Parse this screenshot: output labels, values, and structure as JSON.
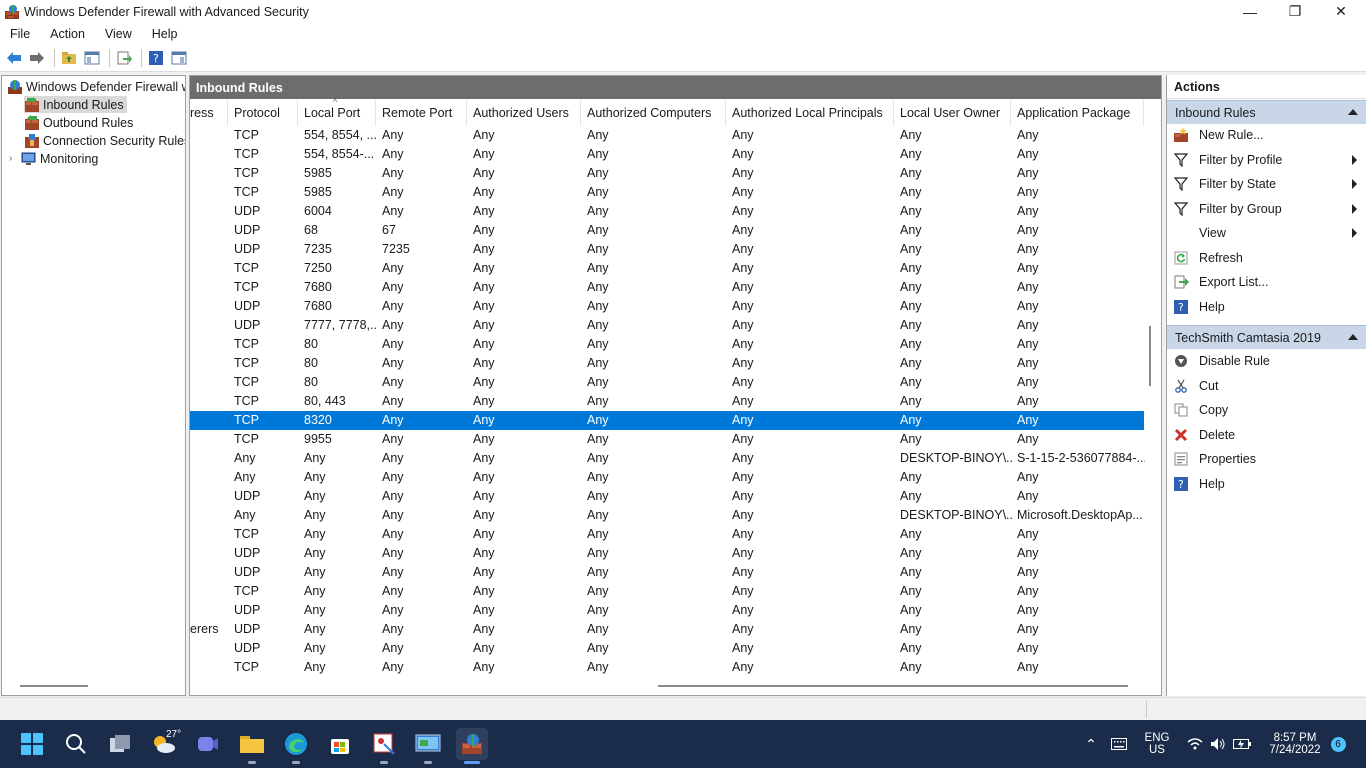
{
  "window": {
    "title": "Windows Defender Firewall with Advanced Security",
    "minimize": "—",
    "maximize": "❐",
    "close": "✕"
  },
  "menu": [
    "File",
    "Action",
    "View",
    "Help"
  ],
  "tree": {
    "root": "Windows Defender Firewall wi",
    "items": [
      "Inbound Rules",
      "Outbound Rules",
      "Connection Security Rules",
      "Monitoring"
    ]
  },
  "center": {
    "header": "Inbound Rules",
    "columns": [
      "ress",
      "Protocol",
      "Local Port",
      "Remote Port",
      "Authorized Users",
      "Authorized Computers",
      "Authorized Local Principals",
      "Local User Owner",
      "Application Package"
    ],
    "rows": [
      [
        "",
        "TCP",
        "554, 8554, ...",
        "Any",
        "Any",
        "Any",
        "Any",
        "Any",
        "Any"
      ],
      [
        "",
        "TCP",
        "554, 8554-...",
        "Any",
        "Any",
        "Any",
        "Any",
        "Any",
        "Any"
      ],
      [
        "",
        "TCP",
        "5985",
        "Any",
        "Any",
        "Any",
        "Any",
        "Any",
        "Any"
      ],
      [
        "",
        "TCP",
        "5985",
        "Any",
        "Any",
        "Any",
        "Any",
        "Any",
        "Any"
      ],
      [
        "",
        "UDP",
        "6004",
        "Any",
        "Any",
        "Any",
        "Any",
        "Any",
        "Any"
      ],
      [
        "",
        "UDP",
        "68",
        "67",
        "Any",
        "Any",
        "Any",
        "Any",
        "Any"
      ],
      [
        "",
        "UDP",
        "7235",
        "7235",
        "Any",
        "Any",
        "Any",
        "Any",
        "Any"
      ],
      [
        "",
        "TCP",
        "7250",
        "Any",
        "Any",
        "Any",
        "Any",
        "Any",
        "Any"
      ],
      [
        "",
        "TCP",
        "7680",
        "Any",
        "Any",
        "Any",
        "Any",
        "Any",
        "Any"
      ],
      [
        "",
        "UDP",
        "7680",
        "Any",
        "Any",
        "Any",
        "Any",
        "Any",
        "Any"
      ],
      [
        "",
        "UDP",
        "7777, 7778,...",
        "Any",
        "Any",
        "Any",
        "Any",
        "Any",
        "Any"
      ],
      [
        "",
        "TCP",
        "80",
        "Any",
        "Any",
        "Any",
        "Any",
        "Any",
        "Any"
      ],
      [
        "",
        "TCP",
        "80",
        "Any",
        "Any",
        "Any",
        "Any",
        "Any",
        "Any"
      ],
      [
        "",
        "TCP",
        "80",
        "Any",
        "Any",
        "Any",
        "Any",
        "Any",
        "Any"
      ],
      [
        "",
        "TCP",
        "80, 443",
        "Any",
        "Any",
        "Any",
        "Any",
        "Any",
        "Any"
      ],
      [
        "",
        "TCP",
        "8320",
        "Any",
        "Any",
        "Any",
        "Any",
        "Any",
        "Any"
      ],
      [
        "",
        "TCP",
        "9955",
        "Any",
        "Any",
        "Any",
        "Any",
        "Any",
        "Any"
      ],
      [
        "",
        "Any",
        "Any",
        "Any",
        "Any",
        "Any",
        "Any",
        "DESKTOP-BINOY\\...",
        "S-1-15-2-536077884-..."
      ],
      [
        "",
        "Any",
        "Any",
        "Any",
        "Any",
        "Any",
        "Any",
        "Any",
        "Any"
      ],
      [
        "",
        "UDP",
        "Any",
        "Any",
        "Any",
        "Any",
        "Any",
        "Any",
        "Any"
      ],
      [
        "",
        "Any",
        "Any",
        "Any",
        "Any",
        "Any",
        "Any",
        "DESKTOP-BINOY\\...",
        "Microsoft.DesktopAp..."
      ],
      [
        "",
        "TCP",
        "Any",
        "Any",
        "Any",
        "Any",
        "Any",
        "Any",
        "Any"
      ],
      [
        "",
        "UDP",
        "Any",
        "Any",
        "Any",
        "Any",
        "Any",
        "Any",
        "Any"
      ],
      [
        "",
        "UDP",
        "Any",
        "Any",
        "Any",
        "Any",
        "Any",
        "Any",
        "Any"
      ],
      [
        "",
        "TCP",
        "Any",
        "Any",
        "Any",
        "Any",
        "Any",
        "Any",
        "Any"
      ],
      [
        "",
        "UDP",
        "Any",
        "Any",
        "Any",
        "Any",
        "Any",
        "Any",
        "Any"
      ],
      [
        "erers",
        "UDP",
        "Any",
        "Any",
        "Any",
        "Any",
        "Any",
        "Any",
        "Any"
      ],
      [
        "",
        "UDP",
        "Any",
        "Any",
        "Any",
        "Any",
        "Any",
        "Any",
        "Any"
      ],
      [
        "",
        "TCP",
        "Any",
        "Any",
        "Any",
        "Any",
        "Any",
        "Any",
        "Any"
      ]
    ],
    "selected_row": 15
  },
  "actions": {
    "title": "Actions",
    "group1": "Inbound Rules",
    "group1_items": [
      {
        "label": "New Rule...",
        "icon": "new-rule-icon",
        "submenu": false
      },
      {
        "label": "Filter by Profile",
        "icon": "filter-icon",
        "submenu": true
      },
      {
        "label": "Filter by State",
        "icon": "filter-icon",
        "submenu": true
      },
      {
        "label": "Filter by Group",
        "icon": "filter-icon",
        "submenu": true
      },
      {
        "label": "View",
        "icon": "",
        "submenu": true
      },
      {
        "label": "Refresh",
        "icon": "refresh-icon",
        "submenu": false
      },
      {
        "label": "Export List...",
        "icon": "export-icon",
        "submenu": false
      },
      {
        "label": "Help",
        "icon": "help-icon",
        "submenu": false
      }
    ],
    "group2": "TechSmith Camtasia 2019",
    "group2_items": [
      {
        "label": "Disable Rule",
        "icon": "disable-icon"
      },
      {
        "label": "Cut",
        "icon": "cut-icon"
      },
      {
        "label": "Copy",
        "icon": "copy-icon"
      },
      {
        "label": "Delete",
        "icon": "delete-icon"
      },
      {
        "label": "Properties",
        "icon": "properties-icon"
      },
      {
        "label": "Help",
        "icon": "help-icon"
      }
    ]
  },
  "taskbar": {
    "weather_temp": "27°",
    "lang_line1": "ENG",
    "lang_line2": "US",
    "time": "8:57 PM",
    "date": "7/24/2022",
    "notification_count": "6"
  },
  "colors": {
    "selection": "#0078d7",
    "header_bar": "#6d6d6d",
    "group_bar": "#c9d6e8",
    "taskbar": "#1b2b4a"
  }
}
